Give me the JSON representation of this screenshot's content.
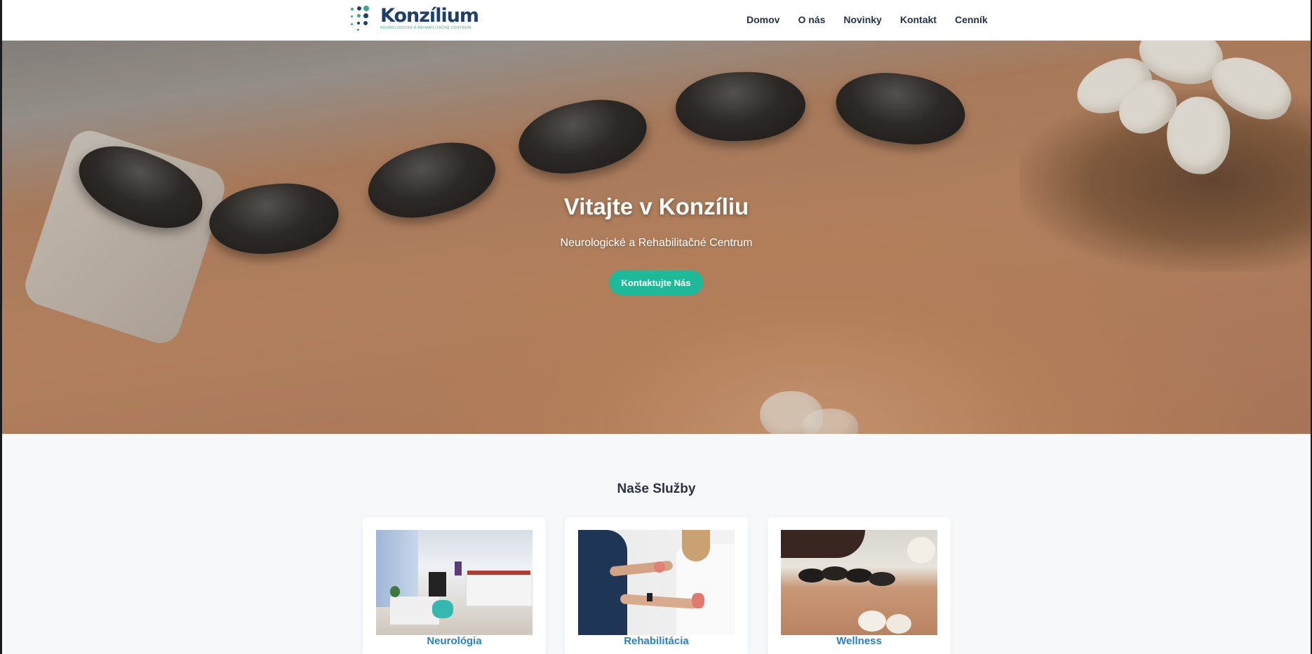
{
  "header": {
    "logo_name": "Konzílium",
    "logo_tagline": "Neurologické a rehabilitačné centrum",
    "nav": [
      "Domov",
      "O nás",
      "Novinky",
      "Kontakt",
      "Cenník"
    ]
  },
  "hero": {
    "title": "Vitajte v Konzíliu",
    "subtitle": "Neurologické a Rehabilitačné Centrum",
    "cta_label": "Kontaktujte Nás"
  },
  "services": {
    "title": "Naše Služby",
    "items": [
      {
        "label": "Neurológia",
        "image": "clinic-room-image"
      },
      {
        "label": "Rehabilitácia",
        "image": "therapy-weights-image"
      },
      {
        "label": "Wellness",
        "image": "hot-stone-massage-image"
      }
    ]
  },
  "colors": {
    "brand_navy": "#1e3f6e",
    "brand_green": "#3aa88a",
    "cta": "#1fb99a",
    "service_link": "#2d7fc0"
  }
}
